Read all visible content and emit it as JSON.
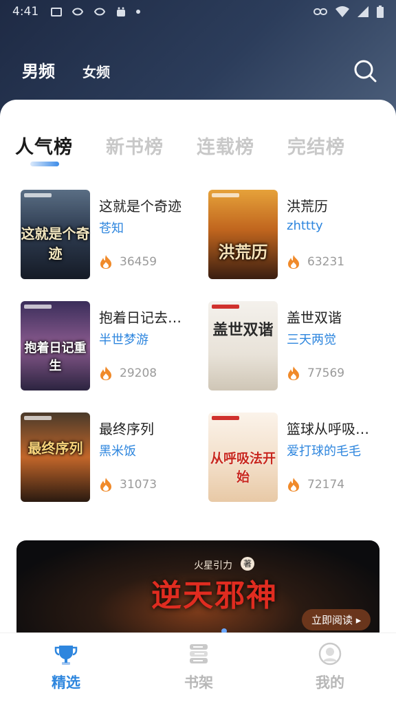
{
  "status_bar": {
    "time": "4:41"
  },
  "header": {
    "tabs": [
      {
        "label": "男频"
      },
      {
        "label": "女频"
      }
    ]
  },
  "ranking_tabs": [
    {
      "label": "人气榜"
    },
    {
      "label": "新书榜"
    },
    {
      "label": "连载榜"
    },
    {
      "label": "完结榜"
    }
  ],
  "books": [
    {
      "title": "这就是个奇迹",
      "author": "苍知",
      "heat": "36459",
      "cover_text": "这就是个奇迹"
    },
    {
      "title": "洪荒历",
      "author": "zhttty",
      "heat": "63231",
      "cover_text": "洪荒历"
    },
    {
      "title": "抱着日记去…",
      "author": "半世梦游",
      "heat": "29208",
      "cover_text": "抱着日记重生"
    },
    {
      "title": "盖世双谐",
      "author": "三天两觉",
      "heat": "77569",
      "cover_text": "盖世双谐"
    },
    {
      "title": "最终序列",
      "author": "黑米饭",
      "heat": "31073",
      "cover_text": "最终序列"
    },
    {
      "title": "篮球从呼吸…",
      "author": "爱打球的毛毛",
      "heat": "72174",
      "cover_text": "从呼吸法开始"
    }
  ],
  "banner": {
    "author": "火星引力",
    "author_badge": "著",
    "title": "逆天邪神",
    "button_label": "立即阅读 ▸"
  },
  "bottom_nav": [
    {
      "label": "精选"
    },
    {
      "label": "书架"
    },
    {
      "label": "我的"
    }
  ],
  "colors": {
    "accent": "#2e86de",
    "heat_icon": "#f08a2a",
    "header_dark": "#1e2a44"
  }
}
